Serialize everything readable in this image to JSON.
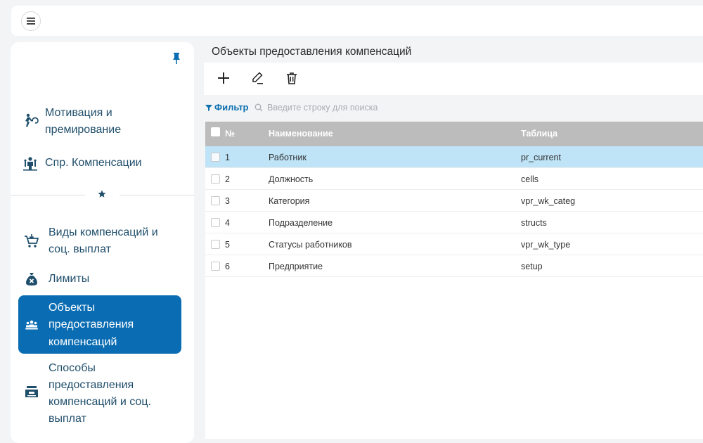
{
  "sidebar": {
    "items": [
      {
        "label_line1": "Мотивация и",
        "label_line2": "премирование",
        "icon": "motivation-run-icon"
      },
      {
        "label": "Спр. Компенсации",
        "icon": "compensation-person-icon"
      },
      {
        "label_line1": "Виды компенсаций и",
        "label_line2": "соц. выплат",
        "icon": "cart-icon"
      },
      {
        "label": "Лимиты",
        "icon": "money-bag-icon"
      },
      {
        "label_line1": "Объекты",
        "label_line2": "предоставления",
        "label_line3": "компенсаций",
        "icon": "group-people-icon"
      },
      {
        "label_line1": "Способы",
        "label_line2": "предоставления",
        "label_line3": "компенсаций и соц.",
        "label_line4": "выплат",
        "icon": "cash-register-icon"
      }
    ]
  },
  "page": {
    "title": "Объекты предоставления компенсаций"
  },
  "filter": {
    "label": "Фильтр",
    "search_placeholder": "Введите строку для поиска"
  },
  "table": {
    "headers": {
      "num": "№",
      "name": "Наименование",
      "table": "Таблица"
    },
    "rows": [
      {
        "num": "1",
        "name": "Работник",
        "table": "pr_current"
      },
      {
        "num": "2",
        "name": "Должность",
        "table": "cells"
      },
      {
        "num": "3",
        "name": "Категория",
        "table": "vpr_wk_categ"
      },
      {
        "num": "4",
        "name": "Подразделение",
        "table": "structs"
      },
      {
        "num": "5",
        "name": "Статусы работников",
        "table": "vpr_wk_type"
      },
      {
        "num": "6",
        "name": "Предприятие",
        "table": "setup"
      }
    ]
  },
  "colors": {
    "accent": "#0a6db3",
    "selected_row": "#bfe3f7",
    "header_bg": "#bcbcbc",
    "nav_text": "#1f4e6b"
  }
}
